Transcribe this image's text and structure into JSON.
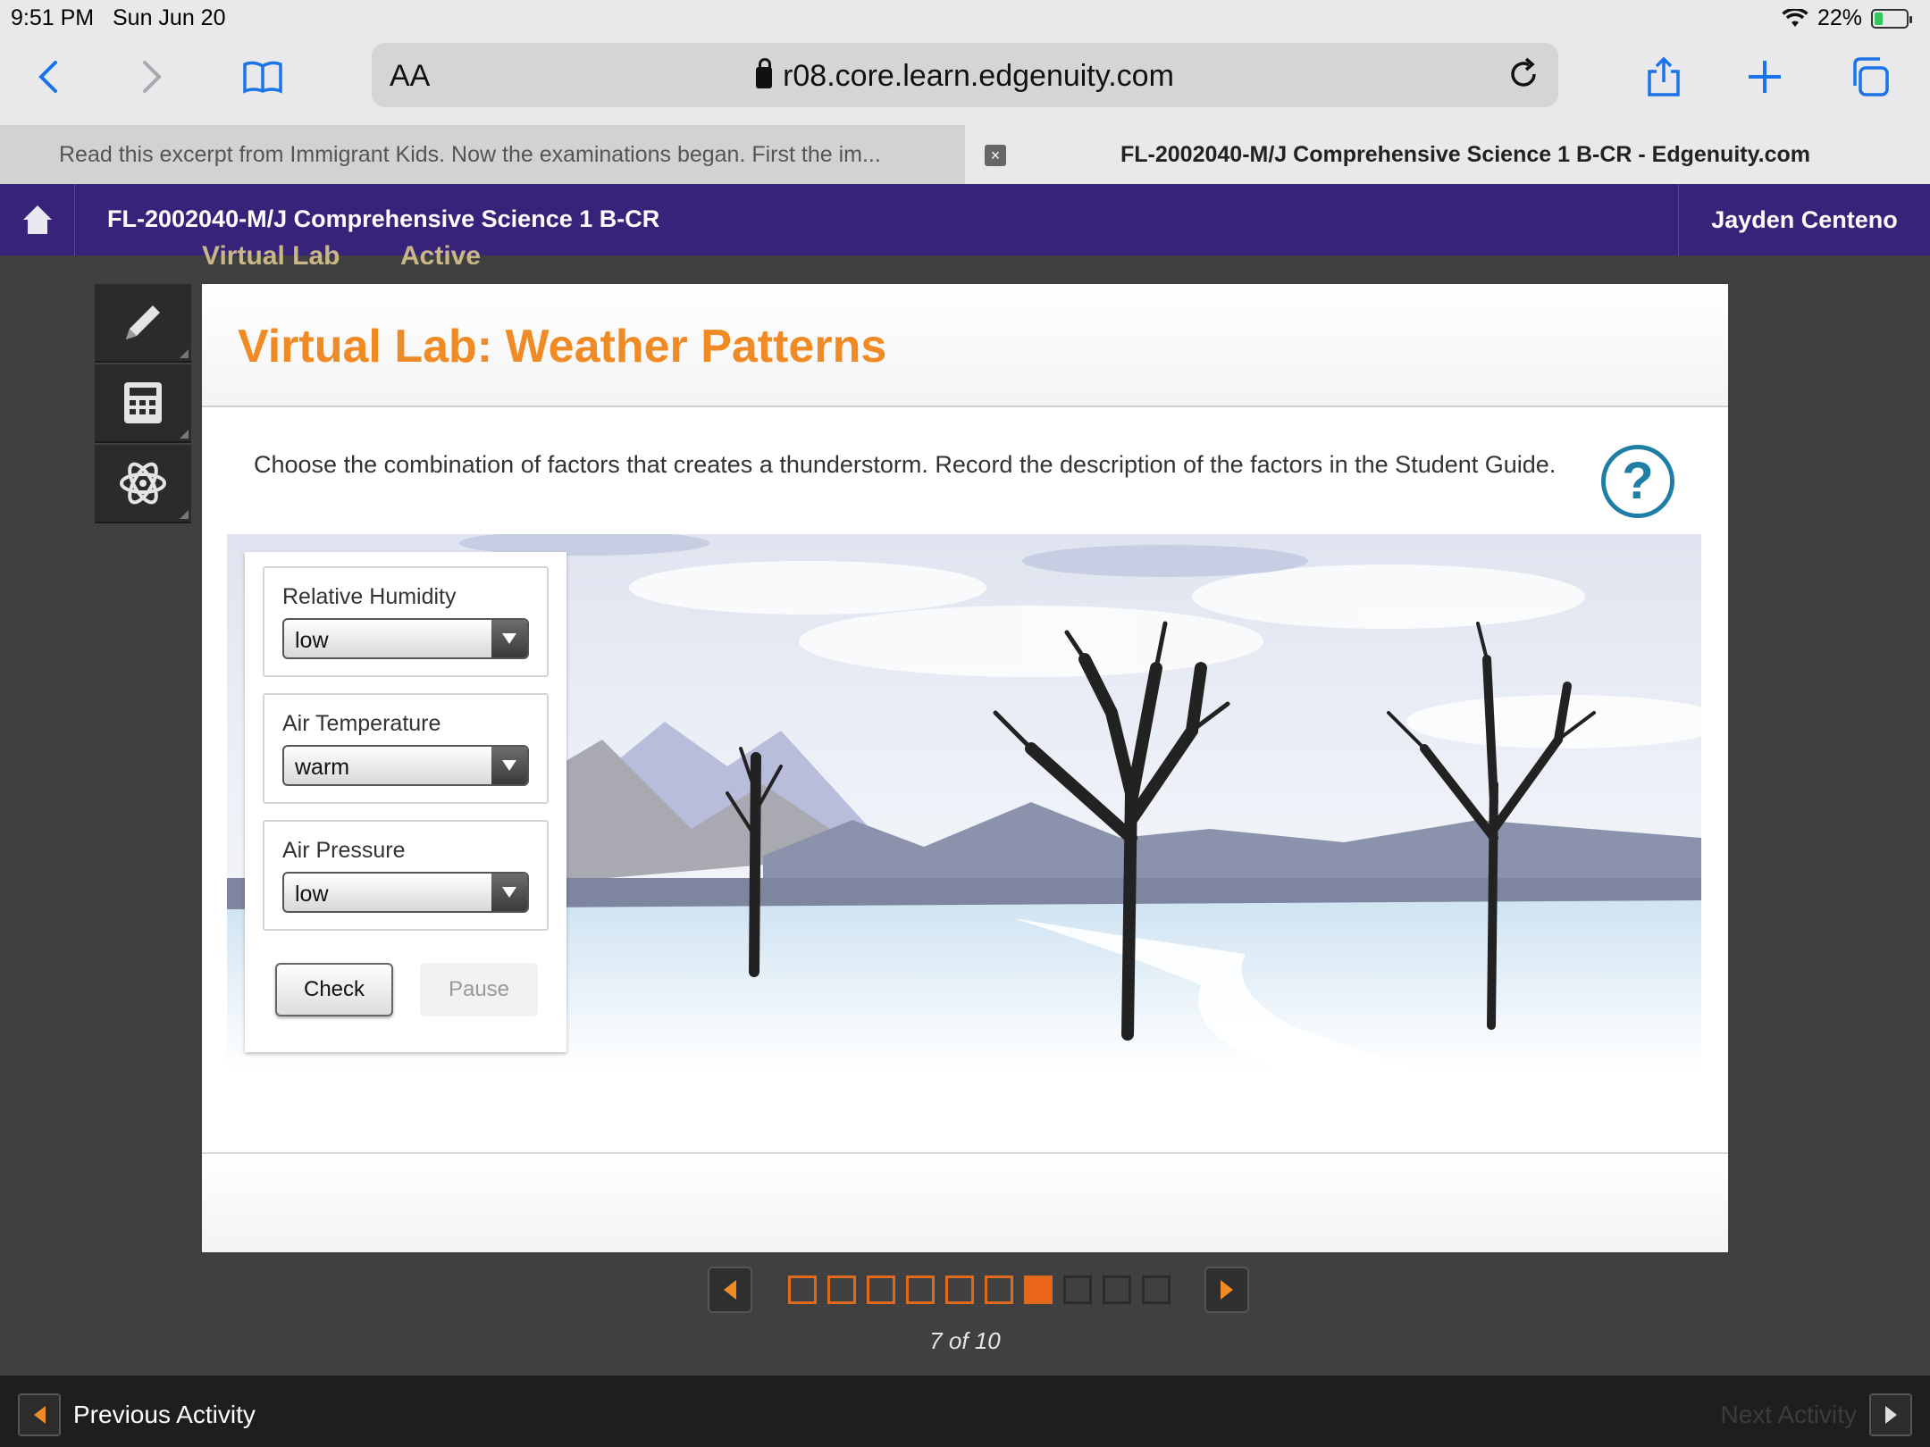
{
  "status_bar": {
    "time": "9:51 PM",
    "date": "Sun Jun 20",
    "battery": "22%"
  },
  "browser": {
    "aa_label": "AA",
    "url": "r08.core.learn.edgenuity.com",
    "tabs": [
      {
        "title": "Read this excerpt from Immigrant Kids. Now the examinations began. First the im...",
        "active": false
      },
      {
        "title": "FL-2002040-M/J Comprehensive Science 1 B-CR - Edgenuity.com",
        "active": true
      }
    ],
    "close_tab_glyph": "×",
    "icons": [
      "back-icon",
      "forward-icon",
      "bookmarks-icon",
      "lock-icon",
      "reload-icon",
      "share-icon",
      "new-tab-icon",
      "tabs-icon"
    ]
  },
  "course": {
    "title": "FL-2002040-M/J Comprehensive Science 1 B-CR",
    "user": "Jayden Centeno"
  },
  "breadcrumb": {
    "activity_type": "Virtual Lab",
    "status": "Active"
  },
  "tools": [
    "pencil-icon",
    "calculator-icon",
    "atom-icon"
  ],
  "lab": {
    "title": "Virtual Lab: Weather Patterns",
    "instruction": "Choose the combination of factors that creates a thunderstorm. Record the description of the factors in the Student Guide.",
    "help_glyph": "?",
    "controls": [
      {
        "label": "Relative Humidity",
        "value": "low"
      },
      {
        "label": "Air Temperature",
        "value": "warm"
      },
      {
        "label": "Air Pressure",
        "value": "low"
      }
    ],
    "check_label": "Check",
    "pause_label": "Pause"
  },
  "pager": {
    "current": 7,
    "total": 10,
    "text": "7 of 10"
  },
  "bottom_nav": {
    "previous": "Previous Activity",
    "next": "Next Activity"
  },
  "colors": {
    "header_purple": "#38237a",
    "accent_orange": "#f08a24",
    "help_blue": "#1f7ea5"
  }
}
